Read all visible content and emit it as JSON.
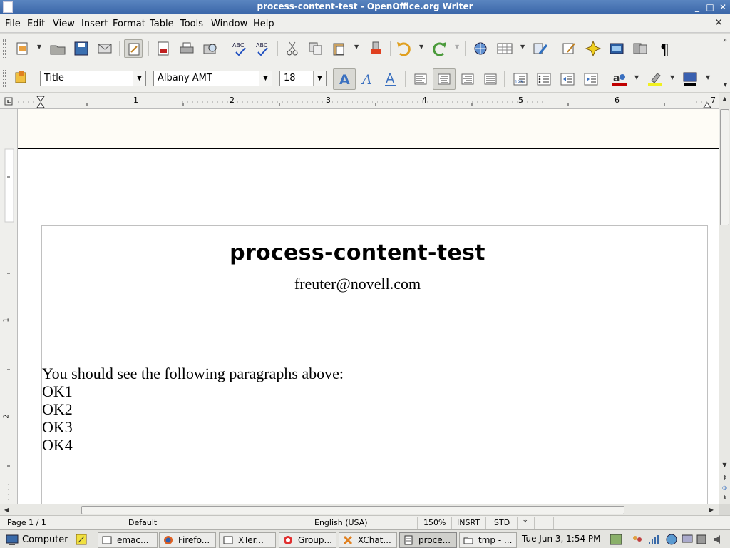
{
  "window": {
    "title": "process-content-test - OpenOffice.org Writer",
    "minimize_glyph": "_",
    "maximize_glyph": "□",
    "close_glyph": "✕"
  },
  "menubar": {
    "items": [
      "File",
      "Edit",
      "View",
      "Insert",
      "Format",
      "Table",
      "Tools",
      "Window",
      "Help"
    ],
    "close_doc_glyph": "✕"
  },
  "formatting": {
    "style": "Title",
    "font": "Albany AMT",
    "size": "18"
  },
  "ruler": {
    "numbers": [
      "1",
      "2",
      "3",
      "4",
      "5",
      "6",
      "7"
    ],
    "vertical_numbers": [
      "1",
      "2"
    ]
  },
  "document": {
    "title": "process-content-test",
    "author": "freuter@novell.com",
    "paragraphs": [
      "You should see the following paragraphs above:",
      "OK1",
      "OK2",
      "OK3",
      "OK4"
    ]
  },
  "statusbar": {
    "page": "Page 1 / 1",
    "page_style": "Default",
    "language": "English (USA)",
    "zoom": "150%",
    "insert_mode": "INSRT",
    "selection_mode": "STD",
    "modified": "*"
  },
  "taskbar": {
    "computer_label": "Computer",
    "items": [
      "emac...",
      "Firefo...",
      "XTer...",
      "Group...",
      "XChat...",
      "proce...",
      "tmp - ..."
    ],
    "clock": "Tue Jun  3,  1:54 PM"
  },
  "colors": {
    "titlebar": "#3a66a8",
    "undo_arrow": "#e0a020",
    "redo_arrow": "#4a9a3a",
    "highlight": "#f0f020",
    "font_color": "#c00000"
  }
}
